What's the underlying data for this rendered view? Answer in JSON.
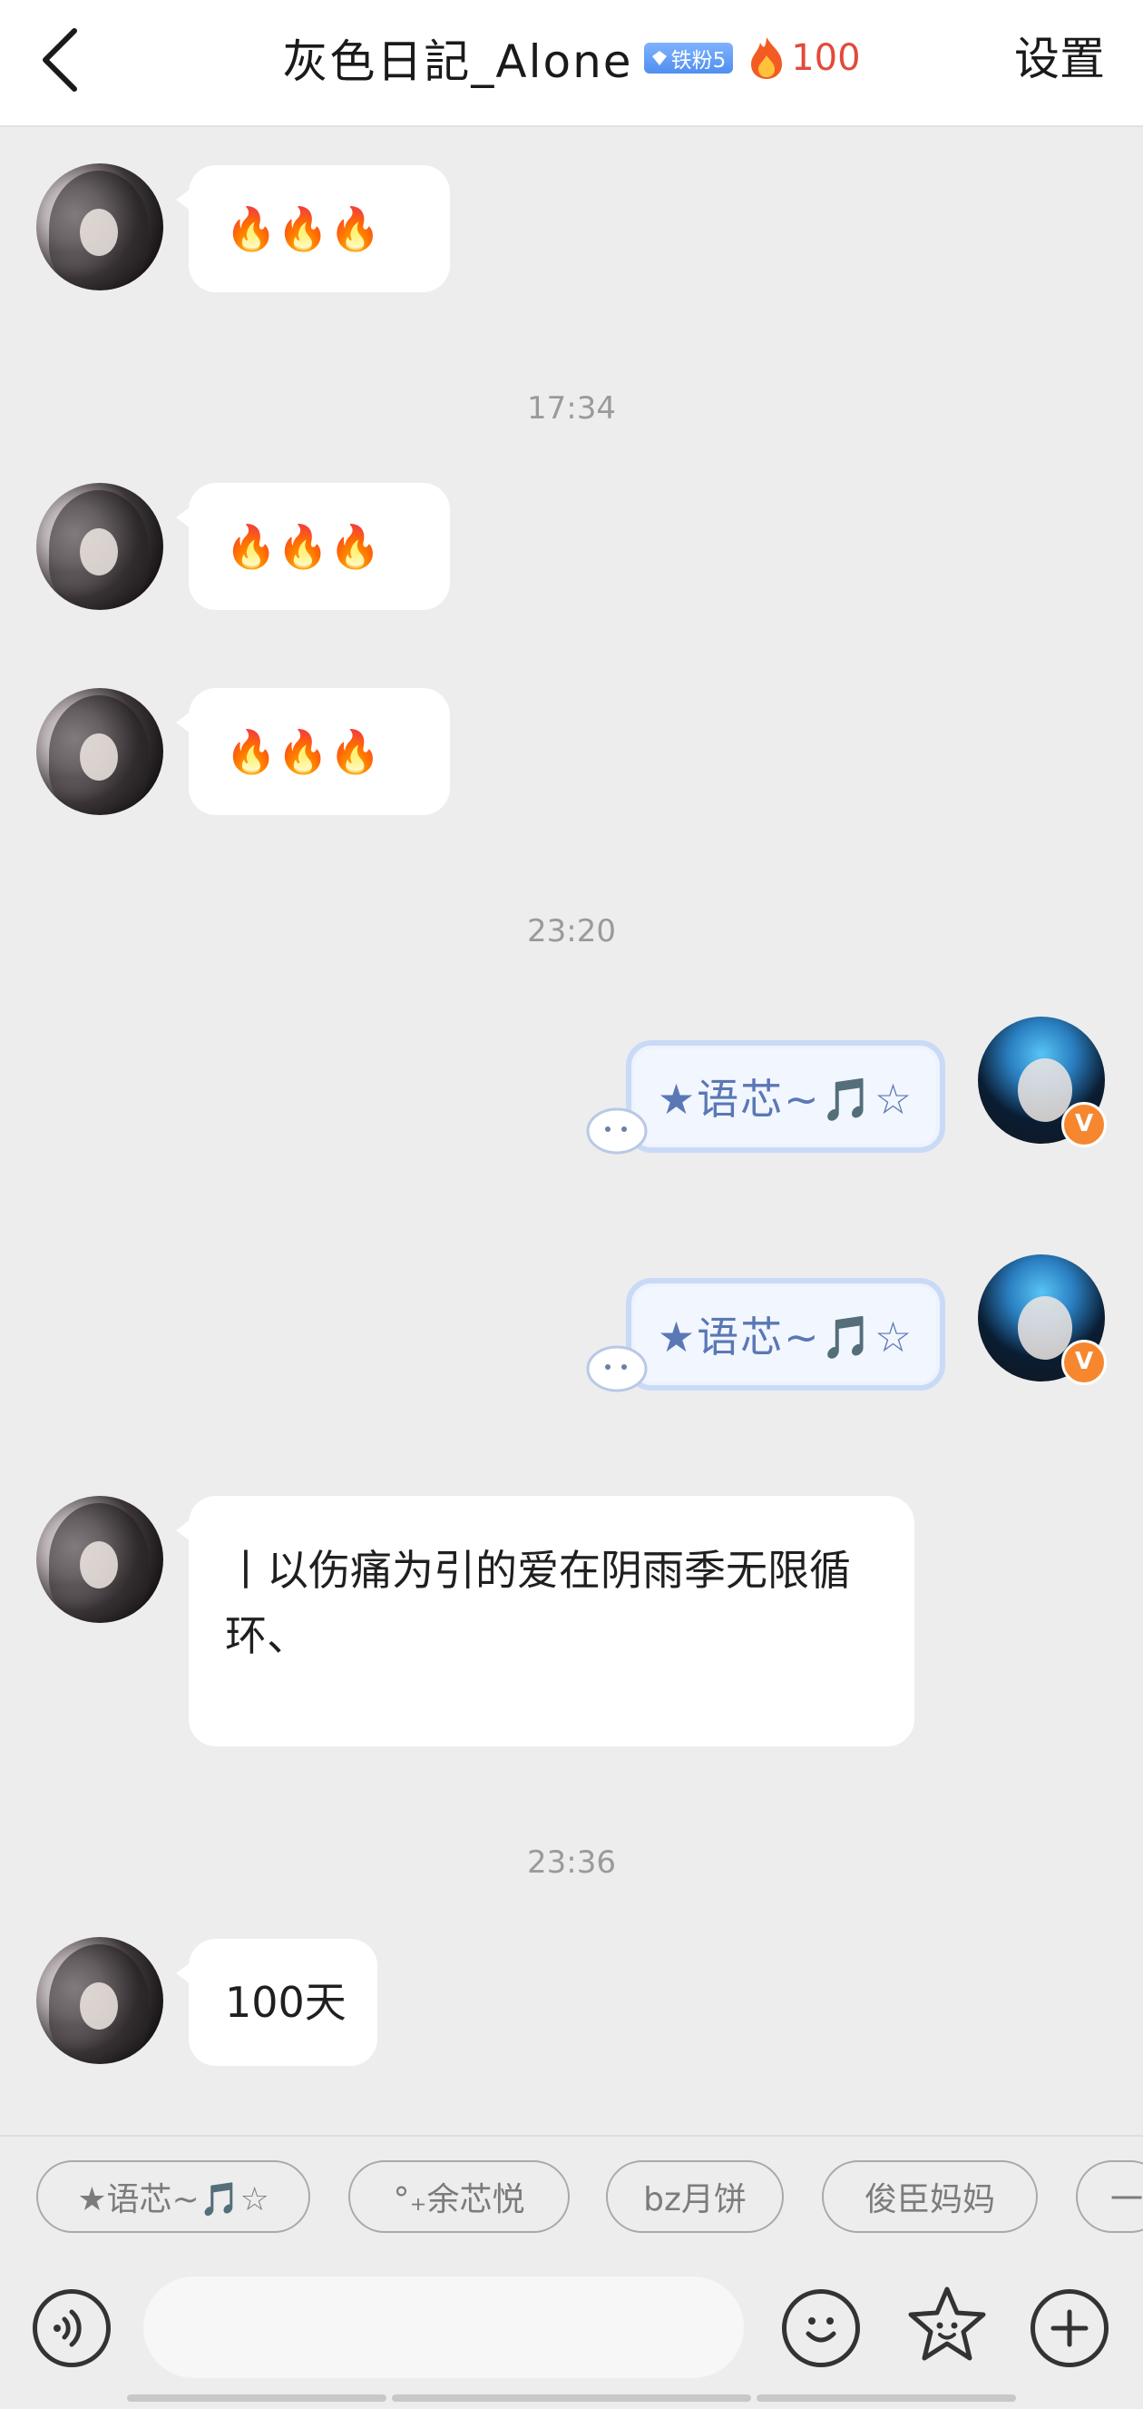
{
  "header": {
    "back_icon": "chevron-left-icon",
    "title": "灰色日記_Alone",
    "fan_badge": "铁粉5",
    "fire_icon": "fire-icon",
    "fire_count": "100",
    "settings_label": "设置"
  },
  "messages": [
    {
      "side": "left",
      "type": "emoji",
      "content": "🔥🔥🔥"
    },
    {
      "type": "time",
      "content": "17:34"
    },
    {
      "side": "left",
      "type": "emoji",
      "content": "🔥🔥🔥"
    },
    {
      "side": "left",
      "type": "emoji",
      "content": "🔥🔥🔥"
    },
    {
      "type": "time",
      "content": "23:20"
    },
    {
      "side": "right",
      "type": "deco",
      "content": "★语芯~🎵☆"
    },
    {
      "side": "right",
      "type": "deco",
      "content": "★语芯~🎵☆"
    },
    {
      "side": "left",
      "type": "text",
      "content": "丨以伤痛为引的爱在阴雨季无限循环、"
    },
    {
      "type": "time",
      "content": "23:36"
    },
    {
      "side": "left",
      "type": "text",
      "content": "100天"
    }
  ],
  "quick_replies": [
    "★语芯~🎵☆",
    "°₊余芯悦",
    "bz月饼",
    "俊臣妈妈",
    "一"
  ],
  "input": {
    "voice_icon": "voice-icon",
    "placeholder": "",
    "emoji_icon": "smiley-icon",
    "sticker_icon": "star-face-icon",
    "plus_icon": "plus-icon"
  },
  "colors": {
    "background": "#ededed",
    "bubble": "#ffffff",
    "fire_number": "#e24a3a",
    "badge_blue": "#4f8ff0",
    "verified_orange": "#f6872f",
    "deco_text": "#5a78b5"
  }
}
